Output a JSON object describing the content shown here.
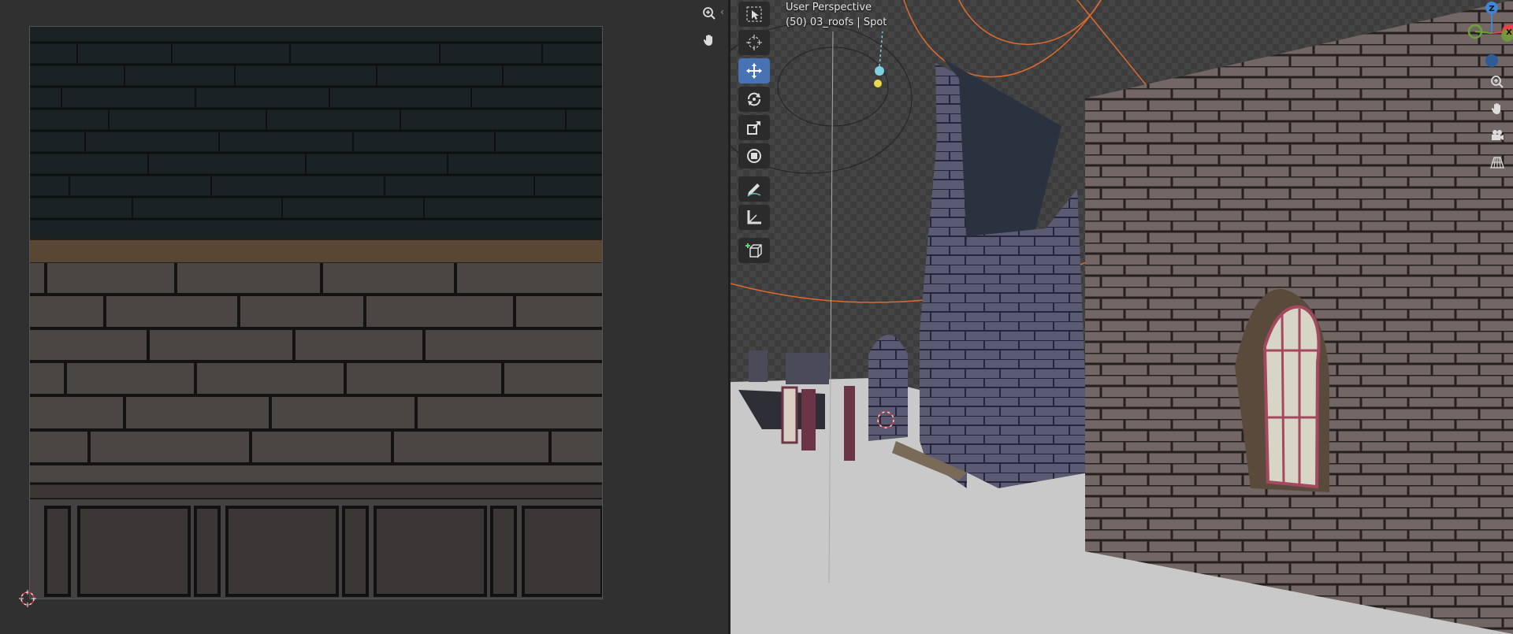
{
  "viewport": {
    "mode_label": "User Perspective",
    "context_label": "(50) 03_roofs | Spot"
  },
  "uv_editor": {
    "tools": [
      {
        "name": "zoom-icon",
        "label": "Zoom"
      },
      {
        "name": "pan-hand-icon",
        "label": "Pan"
      }
    ]
  },
  "toolbar": {
    "tools": [
      "select-box",
      "cursor",
      "move",
      "rotate",
      "scale",
      "transform",
      "annotate",
      "measure",
      "add-cube"
    ],
    "active": "move"
  },
  "gizmo": {
    "axes": [
      "Z",
      "X"
    ]
  },
  "colors": {
    "active_tool": "#4772b3",
    "light_helper": "#e06a2c",
    "axis_x": "#e8434b",
    "axis_y": "#6aa33a",
    "axis_z": "#3f86d8"
  }
}
